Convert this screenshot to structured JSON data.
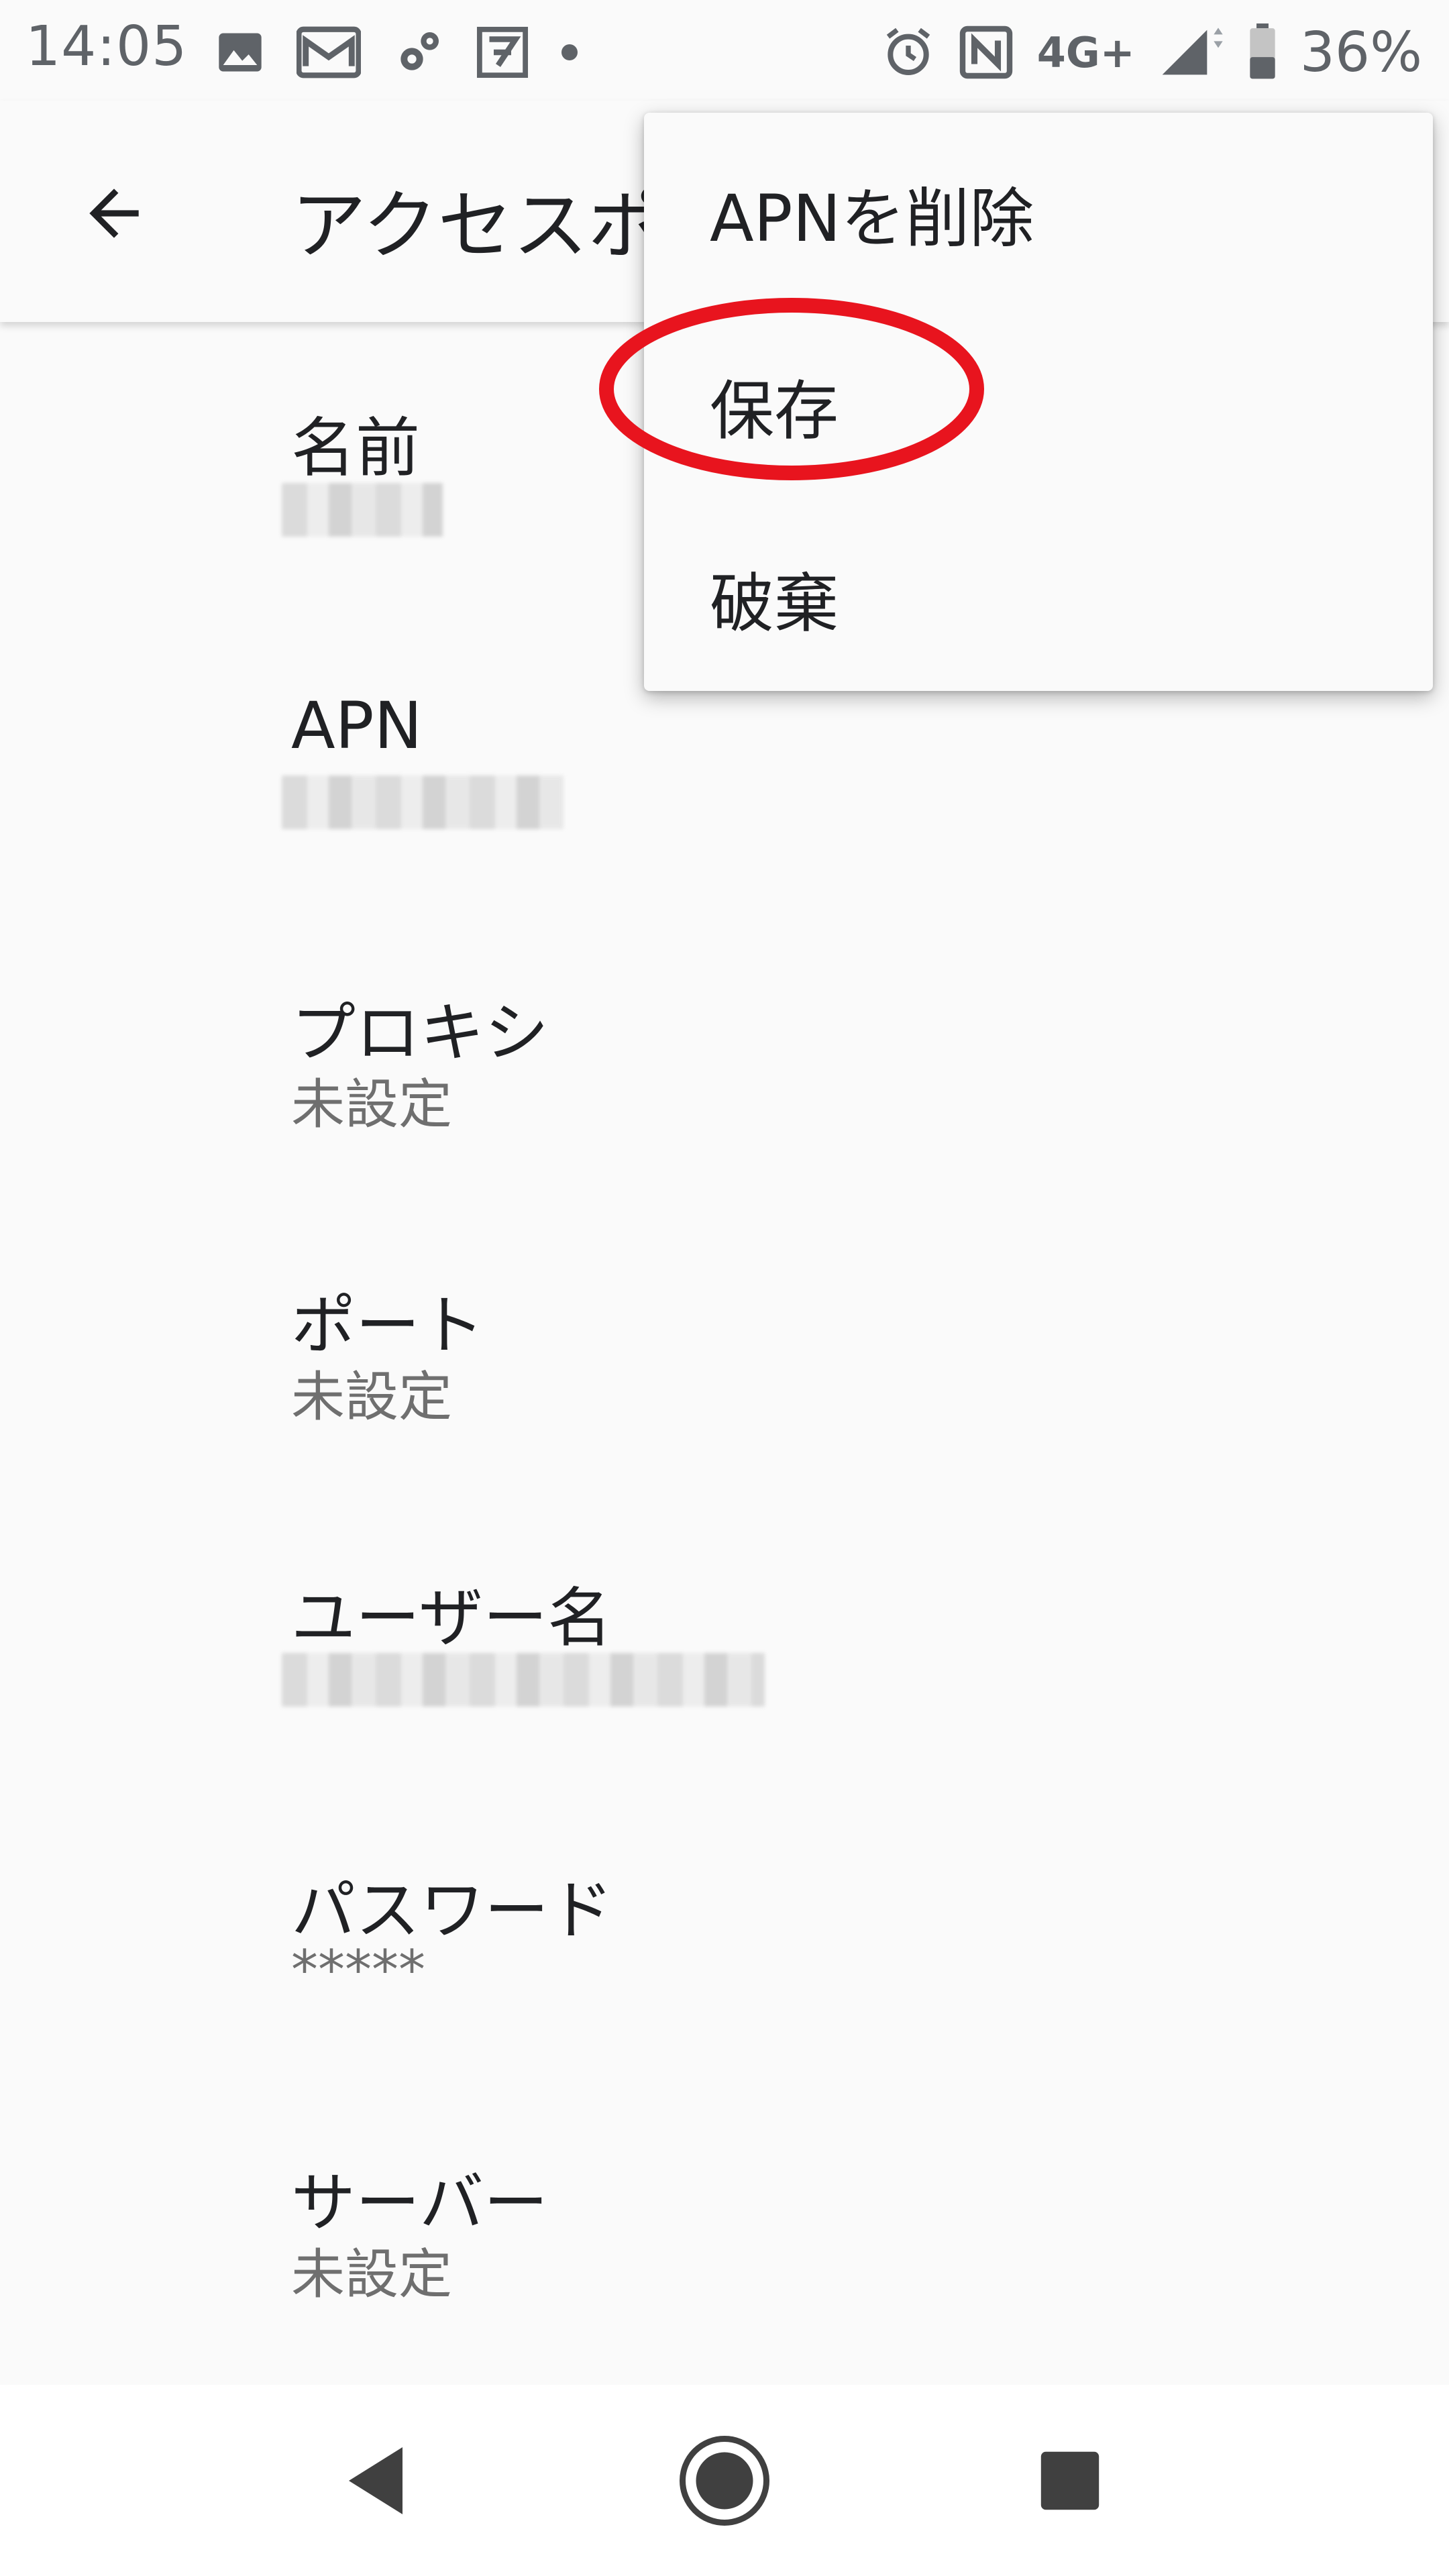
{
  "status_bar": {
    "time": "14:05",
    "left_icons": [
      "image-icon",
      "mail-icon",
      "gear-icon",
      "app-icon",
      "dot-icon"
    ],
    "right_icons": [
      "alarm-icon",
      "nfc-icon",
      "signal-icon",
      "battery-icon"
    ],
    "network": "4G+",
    "battery": "36%"
  },
  "app_bar": {
    "back_icon": "arrow-left-icon",
    "title": "アクセスポ"
  },
  "fields": [
    {
      "label": "名前",
      "value": "",
      "redacted": true
    },
    {
      "label": "APN",
      "value": "",
      "redacted": true
    },
    {
      "label": "プロキシ",
      "value": "未設定"
    },
    {
      "label": "ポート",
      "value": "未設定"
    },
    {
      "label": "ユーザー名",
      "value": "",
      "redacted": true
    },
    {
      "label": "パスワード",
      "value": "*****"
    },
    {
      "label": "サーバー",
      "value": "未設定"
    }
  ],
  "menu": {
    "items": [
      {
        "label": "APNを削除"
      },
      {
        "label": "保存",
        "highlighted": true
      },
      {
        "label": "破棄"
      }
    ]
  },
  "highlight_color": "#e8141e",
  "nav_bar": {
    "icons": [
      "back-triangle-icon",
      "home-circle-icon",
      "recents-square-icon"
    ]
  }
}
